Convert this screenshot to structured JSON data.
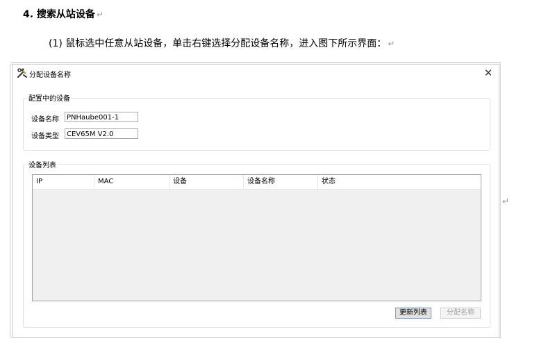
{
  "doc": {
    "heading": "4. 搜索从站设备",
    "instruction": "(1)  鼠标选中任意从站设备，单击右键选择分配设备名称，进入图下所示界面：",
    "para_mark": "↵"
  },
  "dialog": {
    "title": "分配设备名称",
    "close_symbol": "✕",
    "config_group": {
      "label": "配置中的设备",
      "name_label": "设备名称",
      "name_value": "PNHaube001-1",
      "type_label": "设备类型",
      "type_value": "CEV65M V2.0"
    },
    "list_group": {
      "label": "设备列表",
      "columns": [
        "IP",
        "MAC",
        "设备",
        "设备名称",
        "状态"
      ],
      "rows": []
    },
    "buttons": {
      "refresh": "更新列表",
      "assign": "分配名称"
    }
  }
}
